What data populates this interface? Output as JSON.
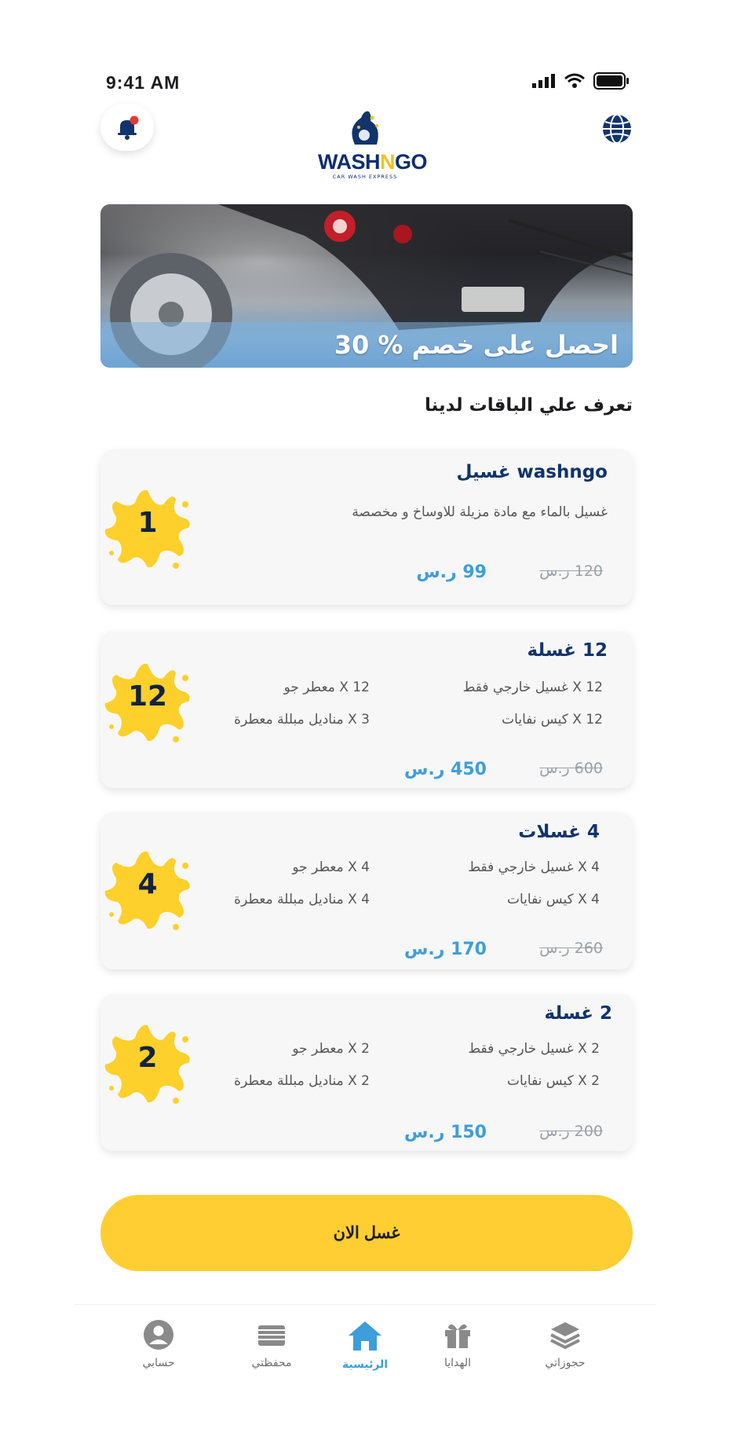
{
  "status_bar": {
    "time": "9:41 AM"
  },
  "header": {
    "logo_text_a": "WASH",
    "logo_text_n": "N",
    "logo_text_b": "GO",
    "logo_sub": "CAR WASH EXPRESS"
  },
  "banner": {
    "text": "احصل على خصم % 30"
  },
  "section_title": "تعرف علي الباقات لدينا",
  "packages": [
    {
      "number": "1",
      "title": "washngo غسيل",
      "description": "غسيل بالماء مع مادة مزيلة للاوساخ و مخصصة",
      "old_price": "120 ر.س",
      "new_price": "99 ر.س"
    },
    {
      "number": "12",
      "title": "12 غسلة",
      "features": [
        "12 X غسيل خارجي فقط",
        "12 X معطر جو",
        "12 X كيس نفايات",
        "3 X مناديل مبللة معطرة"
      ],
      "old_price": "600 ر.س",
      "new_price": "450 ر.س"
    },
    {
      "number": "4",
      "title": "4 غسلات",
      "features": [
        "4 X غسيل خارجي فقط",
        "4 X معطر جو",
        "4 X كيس نفايات",
        "4 X مناديل مبللة معطرة"
      ],
      "old_price": "260 ر.س",
      "new_price": "170 ر.س"
    },
    {
      "number": "2",
      "title": "2 غسلة",
      "features": [
        "2 X غسيل خارجي فقط",
        "2 X معطر جو",
        "2 X كيس نفايات",
        "2 X مناديل مبللة معطرة"
      ],
      "old_price": "200 ر.س",
      "new_price": "150 ر.س"
    }
  ],
  "cta": {
    "label": "غسل الان"
  },
  "nav": {
    "items": [
      {
        "label": "حسابي",
        "icon": "user-icon"
      },
      {
        "label": "محفظتي",
        "icon": "wallet-icon"
      },
      {
        "label": "الرئيسية",
        "icon": "home-icon",
        "active": true
      },
      {
        "label": "الهدايا",
        "icon": "gift-icon"
      },
      {
        "label": "حجوزاتي",
        "icon": "layers-icon"
      }
    ]
  },
  "colors": {
    "accent": "#fece32",
    "primary": "#10346b",
    "price": "#3e9edb",
    "card_bg": "#f7f7f7"
  }
}
